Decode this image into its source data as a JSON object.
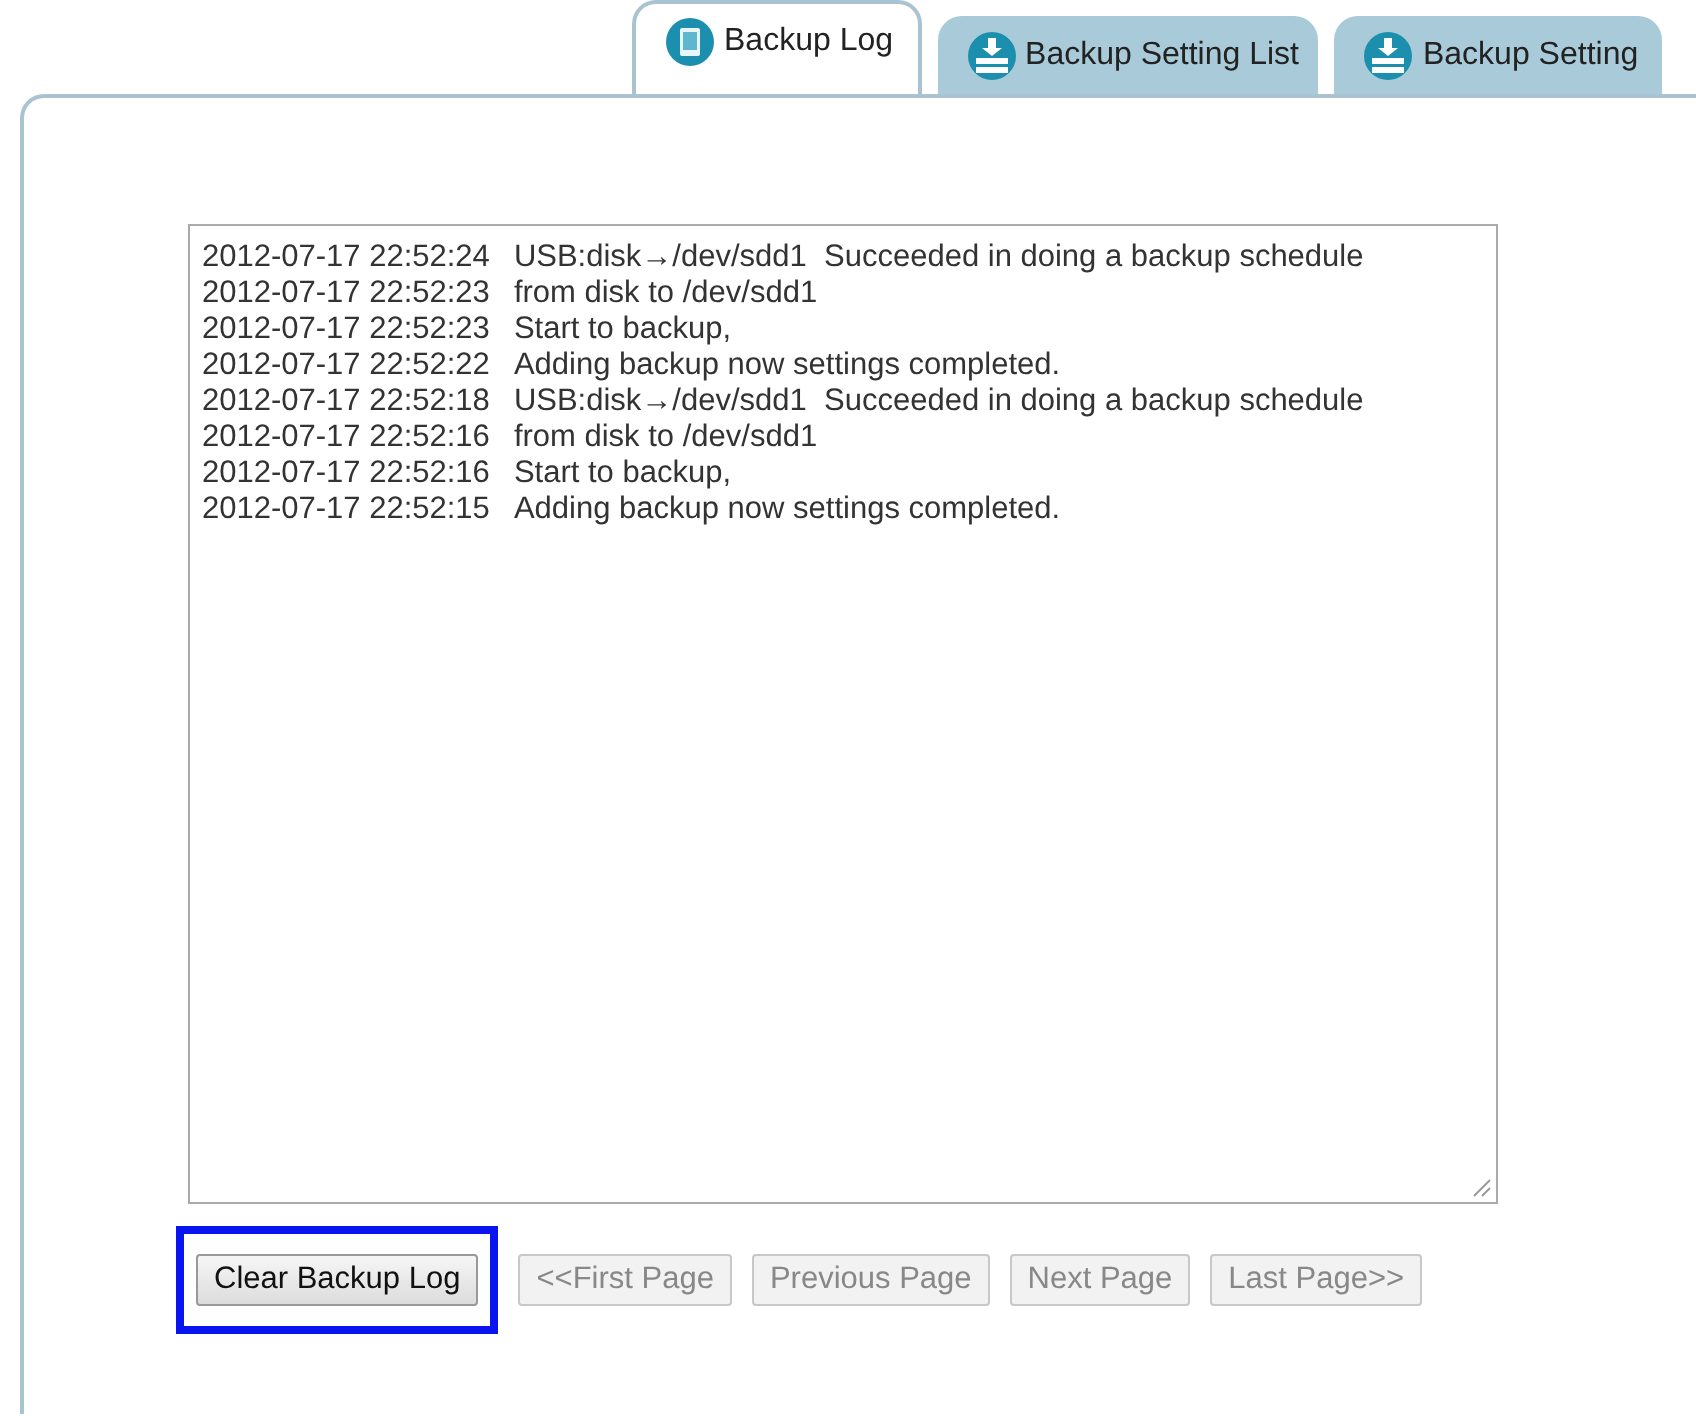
{
  "tabs": [
    {
      "label": "Backup Log",
      "kind": "log",
      "selected": true
    },
    {
      "label": "Backup Setting List",
      "kind": "download",
      "selected": false
    },
    {
      "label": "Backup Setting",
      "kind": "download",
      "selected": false
    }
  ],
  "log": [
    {
      "time": "2012-07-17 22:52:24",
      "message": "USB:disk→/dev/sdd1  Succeeded in doing a backup schedule"
    },
    {
      "time": "2012-07-17 22:52:23",
      "message": "from disk to /dev/sdd1"
    },
    {
      "time": "2012-07-17 22:52:23",
      "message": "Start to backup,"
    },
    {
      "time": "2012-07-17 22:52:22",
      "message": "Adding backup now settings completed."
    },
    {
      "time": "2012-07-17 22:52:18",
      "message": "USB:disk→/dev/sdd1  Succeeded in doing a backup schedule"
    },
    {
      "time": "2012-07-17 22:52:16",
      "message": "from disk to /dev/sdd1"
    },
    {
      "time": "2012-07-17 22:52:16",
      "message": "Start to backup,"
    },
    {
      "time": "2012-07-17 22:52:15",
      "message": "Adding backup now settings completed."
    }
  ],
  "buttons": [
    {
      "label": "Clear Backup Log",
      "disabled": false,
      "highlighted": true
    },
    {
      "label": "<<First Page",
      "disabled": true,
      "highlighted": false
    },
    {
      "label": "Previous Page",
      "disabled": true,
      "highlighted": false
    },
    {
      "label": "Next Page",
      "disabled": true,
      "highlighted": false
    },
    {
      "label": "Last Page>>",
      "disabled": true,
      "highlighted": false
    }
  ]
}
